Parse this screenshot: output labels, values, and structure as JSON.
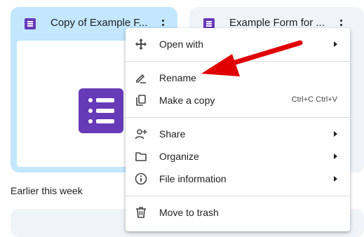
{
  "cards": [
    {
      "title": "Copy of Example F..."
    },
    {
      "title": "Example Form for ..."
    }
  ],
  "section": {
    "earlier_label": "Earlier this week"
  },
  "menu": {
    "open_with": "Open with",
    "rename": "Rename",
    "make_copy": "Make a copy",
    "make_copy_shortcut": "Ctrl+C Ctrl+V",
    "share": "Share",
    "organize": "Organize",
    "file_information": "File information",
    "move_to_trash": "Move to trash"
  },
  "colors": {
    "selected_card": "#c2e7ff",
    "card": "#f0f4f9",
    "forms_purple": "#673ab7",
    "annotation_arrow": "#e00000"
  },
  "icons": [
    "forms-icon",
    "more-vert-icon",
    "open-with-icon",
    "rename-icon",
    "copy-icon",
    "share-icon",
    "folder-icon",
    "info-icon",
    "trash-icon",
    "chevron-right-icon"
  ]
}
